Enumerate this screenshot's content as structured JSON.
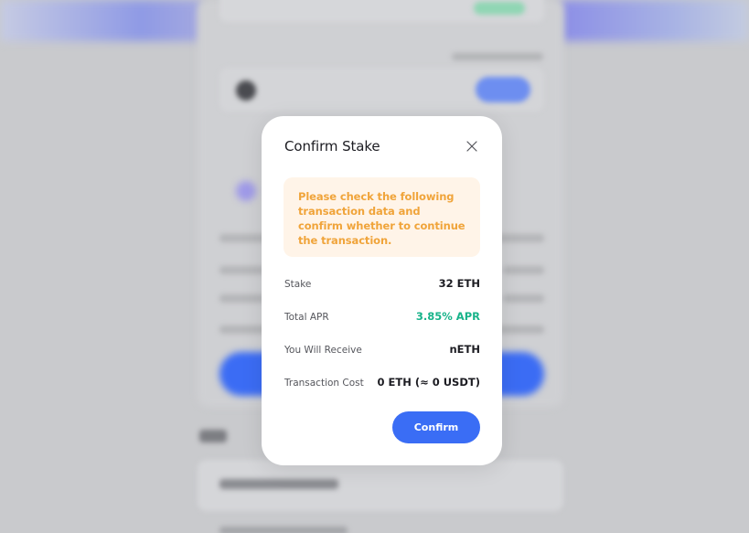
{
  "modal": {
    "title": "Confirm Stake",
    "close_icon": "close-icon",
    "notice": "Please check the following transaction data and confirm whether to continue the transaction.",
    "rows": [
      {
        "label": "Stake",
        "value": "32 ETH"
      },
      {
        "label": "Total APR",
        "value": "3.85% APR"
      },
      {
        "label": "You Will Receive",
        "value": "nETH"
      },
      {
        "label": "Transaction Cost",
        "value": "0 ETH (≈ 0 USDT)"
      }
    ],
    "confirm_label": "Confirm"
  },
  "colors": {
    "accent": "#3a6df5",
    "apr_green": "#18b38a",
    "notice_text": "#f0a43a",
    "notice_bg": "#fff4e8"
  }
}
